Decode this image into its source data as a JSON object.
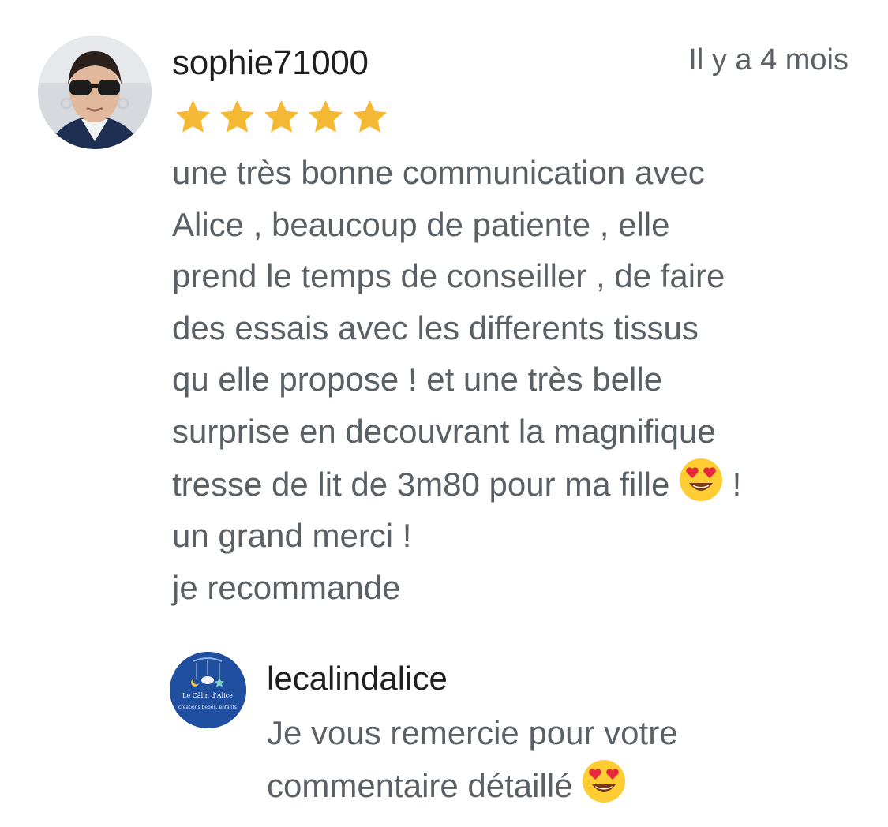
{
  "review": {
    "author": "sophie71000",
    "date": "Il y a 4 mois",
    "rating": 5,
    "star_color": "#F5B835",
    "lines": [
      "une très bonne communication avec",
      "Alice , beaucoup de patiente , elle",
      "prend le temps de conseiller , de faire",
      "des essais avec les differents tissus",
      "qu elle propose ! et une très belle",
      "surprise en decouvrant la magnifique",
      "tresse de lit de 3m80 pour ma fille",
      "!",
      "un grand merci !",
      "je recommande"
    ]
  },
  "reply": {
    "author": "lecalindalice",
    "logo_text": "Le Câlin d'Alice",
    "logo_subtext": "créations bébés, enfants",
    "brand_color": "#1F4F9E",
    "lines": [
      "Je vous remercie pour votre",
      "commentaire détaillé"
    ]
  },
  "icons": {
    "avatar": "user-photo-avatar",
    "reply_avatar": "shop-logo-avatar",
    "star": "star-icon",
    "emoji": "heart-eyes-emoji-icon"
  }
}
